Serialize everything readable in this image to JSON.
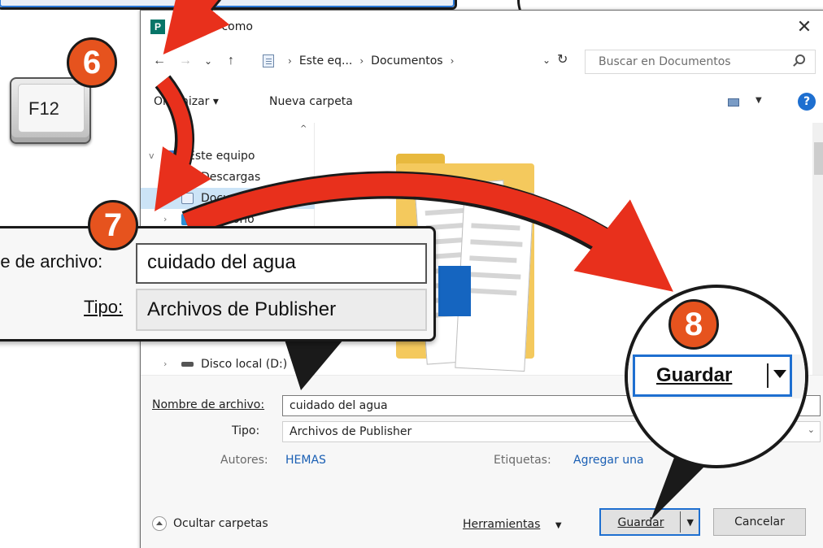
{
  "dialog": {
    "title": "Guardar como",
    "close": "✕"
  },
  "nav": {
    "back": "←",
    "forward": "→",
    "recent": "⌄",
    "up": "↑",
    "crumbs": [
      "Este eq...",
      "Documentos"
    ],
    "refresh": "↻",
    "search_placeholder": "Buscar en Documentos"
  },
  "toolbar": {
    "organize": "Organizar ▾",
    "new_folder": "Nueva carpeta",
    "help": "?"
  },
  "tree": {
    "items": [
      {
        "label": "Este equipo",
        "icon_color": "#3b7dd8"
      },
      {
        "label": "Descargas",
        "icon_color": "#2b78d6"
      },
      {
        "label": "Documentos",
        "icon_color": "#6b86a8"
      },
      {
        "label": "Escritorio",
        "icon_color": "#2b8fd6"
      },
      {
        "label": "Disco local (D:)",
        "icon_color": "#555555"
      }
    ]
  },
  "form": {
    "filename_label": "Nombre de archivo:",
    "filename_value": "cuidado del agua",
    "type_label": "Tipo:",
    "type_value": "Archivos de Publisher",
    "authors_label": "Autores:",
    "authors_value": "HEMAS",
    "tags_label": "Etiquetas:",
    "tags_value": "Agregar una"
  },
  "footer": {
    "hide_folders": "Ocultar carpetas",
    "tools": "Herramientas",
    "save": "Guardar",
    "cancel": "Cancelar"
  },
  "callouts": {
    "key": "F12",
    "step6": "6",
    "step7": "7",
    "step8": "8",
    "zoom_filename_label": "re de archivo:",
    "zoom_filename_value": "cuidado del agua",
    "zoom_type_label": "Tipo:",
    "zoom_type_value": "Archivos de Publisher",
    "zoom_save": "Guardar"
  },
  "colors": {
    "accent": "#1e6fd0",
    "arrow": "#e8301c",
    "badge": "#e6531e",
    "publisher": "#077568"
  }
}
